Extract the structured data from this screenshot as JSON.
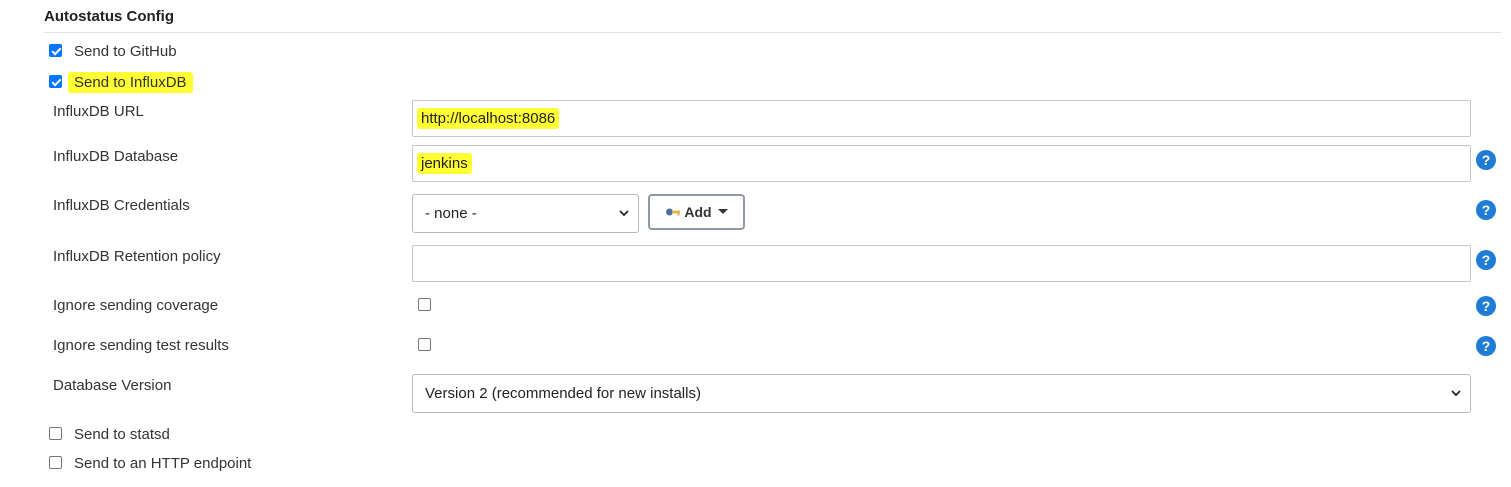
{
  "section": {
    "title": "Autostatus Config"
  },
  "checkboxes": {
    "github": {
      "label": "Send to GitHub",
      "checked": true
    },
    "influxdb": {
      "label": "Send to InfluxDB",
      "checked": true
    },
    "statsd": {
      "label": "Send to statsd",
      "checked": false
    },
    "http": {
      "label": "Send to an HTTP endpoint",
      "checked": false
    }
  },
  "influx": {
    "url": {
      "label": "InfluxDB URL",
      "value": "http://localhost:8086"
    },
    "database": {
      "label": "InfluxDB Database",
      "value": "jenkins"
    },
    "credentials": {
      "label": "InfluxDB Credentials",
      "selected": "- none -",
      "add_label": "Add"
    },
    "retention": {
      "label": "InfluxDB Retention policy",
      "value": ""
    },
    "ignore_coverage": {
      "label": "Ignore sending coverage",
      "checked": false
    },
    "ignore_tests": {
      "label": "Ignore sending test results",
      "checked": false
    },
    "db_version": {
      "label": "Database Version",
      "selected": "Version 2 (recommended for new installs)"
    }
  },
  "help": {
    "glyph": "?"
  },
  "colors": {
    "highlight": "#ffff33",
    "accent": "#0075ff",
    "help": "#1f7cd6"
  }
}
